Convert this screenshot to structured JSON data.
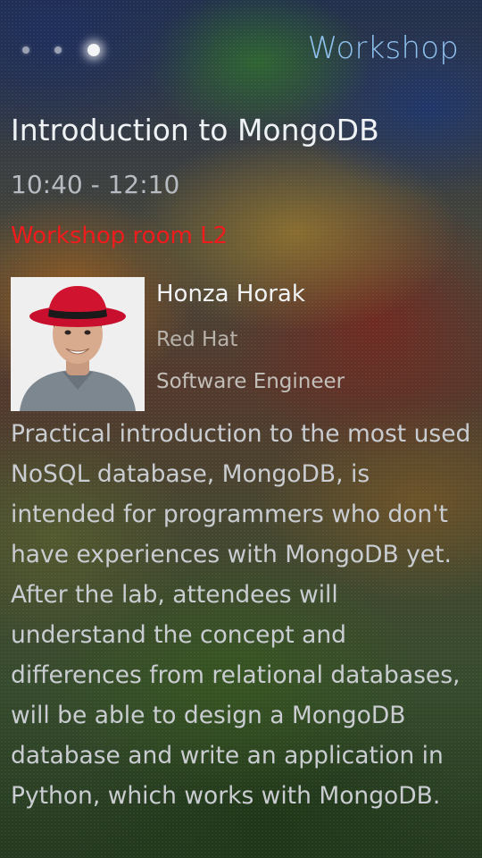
{
  "header": {
    "title": "Workshop",
    "pager": {
      "count": 3,
      "active_index": 2
    }
  },
  "event": {
    "title": "Introduction to MongoDB",
    "time": "10:40 - 12:10",
    "room": "Workshop room L2"
  },
  "speaker": {
    "name": "Honza Horak",
    "company": "Red Hat",
    "role": "Software Engineer",
    "avatar_icon": "speaker-photo"
  },
  "description": "Practical introduction to the most used NoSQL database, MongoDB, is intended for programmers who don't have experiences with MongoDB yet. After the lab, attendees will understand the concept and differences from relational databases, will be able to design a MongoDB database and write an application in Python, which works with MongoDB.",
  "colors": {
    "header_accent": "#8fc0ec",
    "room_accent": "#ee1c1c"
  }
}
